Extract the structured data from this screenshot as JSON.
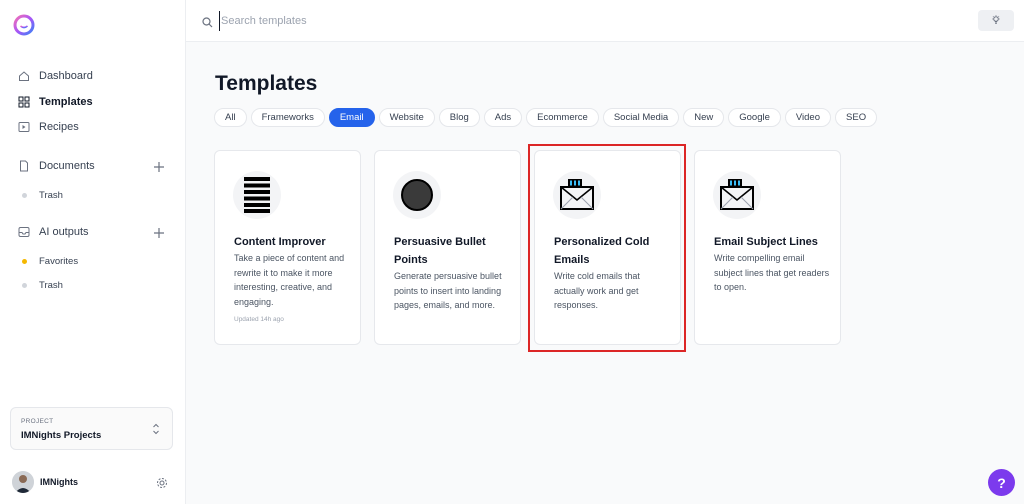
{
  "sidebar": {
    "nav": [
      {
        "label": "Dashboard",
        "icon": "home-icon"
      },
      {
        "label": "Templates",
        "icon": "grid-icon"
      },
      {
        "label": "Recipes",
        "icon": "play-square-icon"
      }
    ],
    "documents": {
      "label": "Documents",
      "items": [
        "Trash"
      ]
    },
    "ai_outputs": {
      "label": "AI outputs",
      "items": [
        "Favorites",
        "Trash"
      ]
    },
    "project": {
      "caption": "PROJECT",
      "name": "IMNights Projects"
    },
    "user": {
      "name": "IMNights"
    }
  },
  "search": {
    "placeholder": "Search templates",
    "value": ""
  },
  "main": {
    "title": "Templates",
    "tabs": [
      "All",
      "Frameworks",
      "Email",
      "Website",
      "Blog",
      "Ads",
      "Ecommerce",
      "Social Media",
      "New",
      "Google",
      "Video",
      "SEO"
    ],
    "active_tab": "Email",
    "cards": [
      {
        "title": "Content Improver",
        "desc": "Take a piece of content and rewrite it to make it more interesting, creative, and engaging.",
        "meta": "Updated 14h ago",
        "icon": "content-lines-icon"
      },
      {
        "title": "Persuasive Bullet Points",
        "desc": "Generate persuasive bullet points to insert into landing pages, emails, and more.",
        "meta": "",
        "icon": "bullet-circle-icon"
      },
      {
        "title": "Personalized Cold Emails",
        "desc": "Write cold emails that actually work and get responses.",
        "meta": "",
        "icon": "envelope-icon"
      },
      {
        "title": "Email Subject Lines",
        "desc": "Write compelling email subject lines that get readers to open.",
        "meta": "",
        "icon": "envelope-icon"
      }
    ]
  },
  "help": {
    "label": "?"
  },
  "colors": {
    "accent": "#2563eb",
    "highlight": "#dc2626",
    "help": "#7c3aed",
    "favorite_dot": "#f5b800"
  }
}
